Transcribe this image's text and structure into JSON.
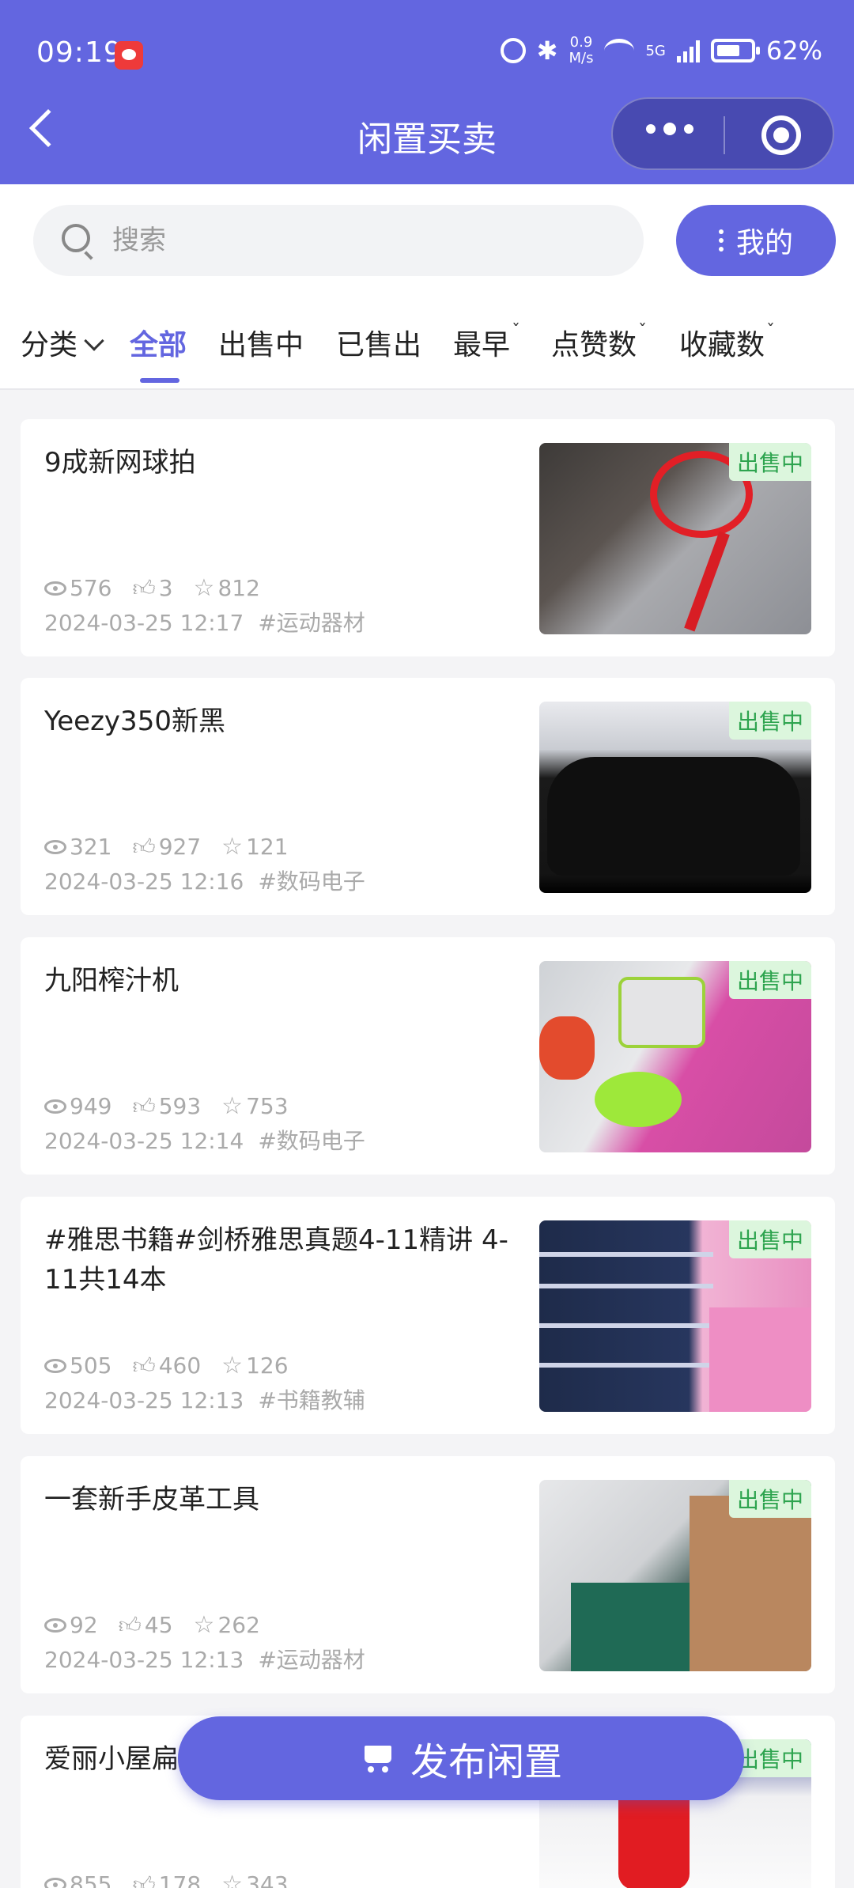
{
  "status_bar": {
    "time": "09:19",
    "net_speed_value": "0.9",
    "net_speed_unit": "M/s",
    "network": "5G",
    "battery": "62%"
  },
  "nav": {
    "title": "闲置买卖"
  },
  "search": {
    "placeholder": "搜索"
  },
  "mine_button": "我的",
  "tabs": {
    "category": "分类",
    "all": "全部",
    "on_sale": "出售中",
    "sold": "已售出",
    "earliest": "最早",
    "likes": "点赞数",
    "favorites": "收藏数"
  },
  "items": [
    {
      "title": "9成新网球拍",
      "views": "576",
      "likes": "3",
      "favorites": "812",
      "datetime": "2024-03-25 12:17",
      "tag": "#运动器材",
      "status": "出售中"
    },
    {
      "title": "Yeezy350新黑",
      "views": "321",
      "likes": "927",
      "favorites": "121",
      "datetime": "2024-03-25 12:16",
      "tag": "#数码电子",
      "status": "出售中"
    },
    {
      "title": "九阳榨汁机",
      "views": "949",
      "likes": "593",
      "favorites": "753",
      "datetime": "2024-03-25 12:14",
      "tag": "#数码电子",
      "status": "出售中"
    },
    {
      "title": "#雅思书籍#剑桥雅思真题4-11精讲 4-11共14本",
      "views": "505",
      "likes": "460",
      "favorites": "126",
      "datetime": "2024-03-25 12:13",
      "tag": "#书籍教辅",
      "status": "出售中"
    },
    {
      "title": "一套新手皮革工具",
      "views": "92",
      "likes": "45",
      "favorites": "262",
      "datetime": "2024-03-25 12:13",
      "tag": "#运动器材",
      "status": "出售中"
    },
    {
      "title": "爱丽小屋扁",
      "views": "855",
      "likes": "178",
      "favorites": "343",
      "datetime": "",
      "tag": "",
      "status": "出售中"
    }
  ],
  "publish_button": "发布闲置",
  "colors": {
    "primary": "#6366e0",
    "status_green": "#2ea44f",
    "status_green_bg": "#dcf6dd"
  }
}
